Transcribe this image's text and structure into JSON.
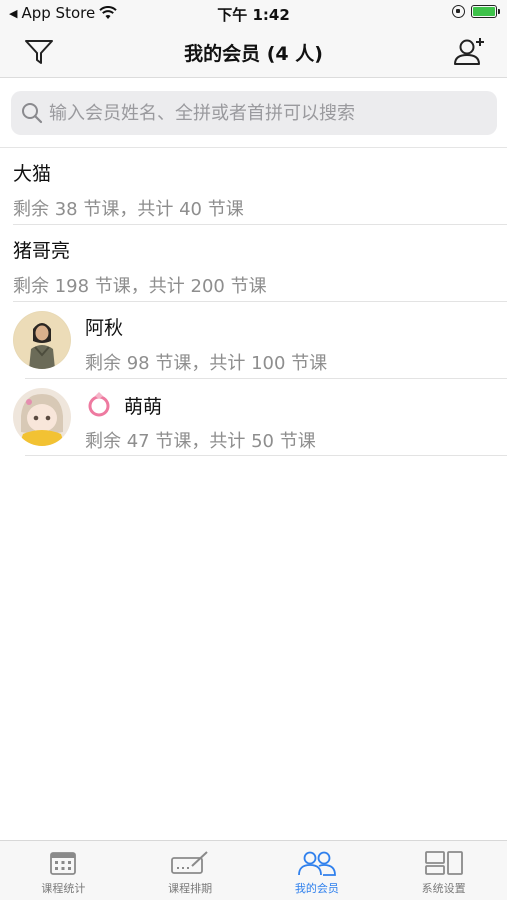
{
  "status_bar": {
    "back_app": "App Store",
    "time": "下午 1:42"
  },
  "nav": {
    "title": "我的会员 (4 人)",
    "left_icon": "filter-icon",
    "right_icon": "add-user-icon"
  },
  "search": {
    "placeholder": "输入会员姓名、全拼或者首拼可以搜索",
    "value": ""
  },
  "members": [
    {
      "name": "大猫",
      "summary": "剩余 38 节课，共计 40 节课",
      "has_avatar": false
    },
    {
      "name": "猪哥亮",
      "summary": "剩余 198 节课，共计 200 节课",
      "has_avatar": false
    },
    {
      "name": "阿秋",
      "summary": "剩余 98 节课，共计 100 节课",
      "has_avatar": true
    },
    {
      "name": "萌萌",
      "summary": "剩余 47 节课，共计 50 节课",
      "has_avatar": true,
      "badge_icon": "ring-icon"
    }
  ],
  "tabs": [
    {
      "label": "课程统计",
      "icon": "calendar-icon",
      "active": false
    },
    {
      "label": "课程排期",
      "icon": "schedule-icon",
      "active": false
    },
    {
      "label": "我的会员",
      "icon": "members-icon",
      "active": true
    },
    {
      "label": "系统设置",
      "icon": "settings-icon",
      "active": false
    }
  ],
  "colors": {
    "accent": "#2f80ed",
    "battery": "#3ec24a",
    "secondary_text": "#8e8e8e"
  }
}
